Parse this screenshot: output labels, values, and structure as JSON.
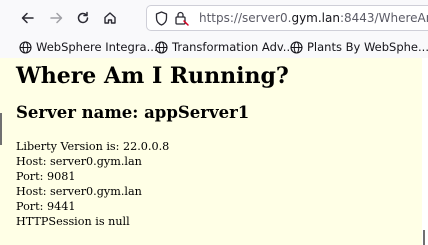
{
  "browser": {
    "url_prefix": "https://server0.",
    "url_host": "gym.lan",
    "url_suffix": ":8443/WhereAmI"
  },
  "bookmarks": [
    {
      "label": "WebSphere Integra..."
    },
    {
      "label": "Transformation Adv..."
    },
    {
      "label": "Plants By WebSphe..."
    }
  ],
  "page": {
    "title": "Where Am I Running?",
    "server_name": "Server name: appServer1",
    "lines": [
      "Liberty Version is: 22.0.0.8",
      "Host: server0.gym.lan",
      "Port: 9081",
      "Host: server0.gym.lan",
      "Port: 9441",
      "HTTPSession is null"
    ],
    "background_color": "#ffffe6"
  }
}
